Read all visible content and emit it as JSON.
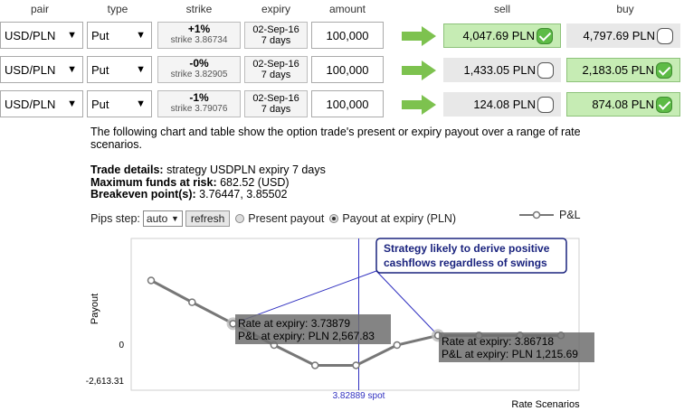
{
  "headers": [
    "pair",
    "type",
    "strike",
    "expiry",
    "amount",
    "sell",
    "buy"
  ],
  "rows": [
    {
      "pair": "USD/PLN",
      "type": "Put",
      "strike_pct": "+1%",
      "strike_val": "strike 3.86734",
      "expiry_date": "02-Sep-16",
      "expiry_days": "7 days",
      "amount": "100,000",
      "sell": "4,047.69 PLN",
      "buy": "4,797.69 PLN",
      "selected": "sell"
    },
    {
      "pair": "USD/PLN",
      "type": "Put",
      "strike_pct": "-0%",
      "strike_val": "strike 3.82905",
      "expiry_date": "02-Sep-16",
      "expiry_days": "7 days",
      "amount": "100,000",
      "sell": "1,433.05 PLN",
      "buy": "2,183.05 PLN",
      "selected": "buy"
    },
    {
      "pair": "USD/PLN",
      "type": "Put",
      "strike_pct": "-1%",
      "strike_val": "strike 3.79076",
      "expiry_date": "02-Sep-16",
      "expiry_days": "7 days",
      "amount": "100,000",
      "sell": "124.08 PLN",
      "buy": "874.08 PLN",
      "selected": "buy"
    }
  ],
  "description": "The following chart and table show the option trade's present or expiry payout over a range of rate scenarios.",
  "details": {
    "trade_label": "Trade details:",
    "trade_value": " strategy USDPLN expiry 7 days",
    "funds_label": "Maximum funds at risk:",
    "funds_value": " 682.52 (USD)",
    "breakeven_label": "Breakeven point(s):",
    "breakeven_value": " 3.76447, 3.85502"
  },
  "controls": {
    "pips_label": "Pips step:",
    "pips_value": "auto",
    "refresh_label": "refresh",
    "present_label": "Present payout",
    "expiry_label": "Payout at expiry (PLN)",
    "selected": "expiry"
  },
  "colors": {
    "accent_arrow": "#7dc24f",
    "selected_green": "#c6ecb4",
    "callout_border": "#1a237e",
    "callout_text": "#1a237e",
    "spot_line": "#3030c0",
    "series": "#777777"
  },
  "chart_data": {
    "type": "line",
    "series": [
      {
        "name": "P&L",
        "values": [
          4650,
          3080,
          1540,
          0,
          -1460,
          -1460,
          0,
          690,
          690,
          690,
          690
        ]
      }
    ],
    "x_index": [
      0,
      1,
      2,
      3,
      4,
      5,
      6,
      7,
      8,
      9,
      10
    ],
    "ylabel": "Payout",
    "xlabel": "Rate Scenarios",
    "y_ticks": [
      {
        "value": 0,
        "label": "0"
      },
      {
        "value": -2613.31,
        "label": "-2,613.31"
      }
    ],
    "spot_label": "3.82889 spot",
    "spot_index": 5,
    "legend": "top-right",
    "callout": "Strategy likely to derive positive cashflows regardless of swings",
    "tooltips": [
      {
        "point_index": 2,
        "line1": "Rate at expiry: 3.73879",
        "line2": "P&L at expiry: PLN 2,567.83"
      },
      {
        "point_index": 7,
        "line1": "Rate at expiry: 3.86718",
        "line2": "P&L at expiry: PLN 1,215.69"
      }
    ]
  }
}
